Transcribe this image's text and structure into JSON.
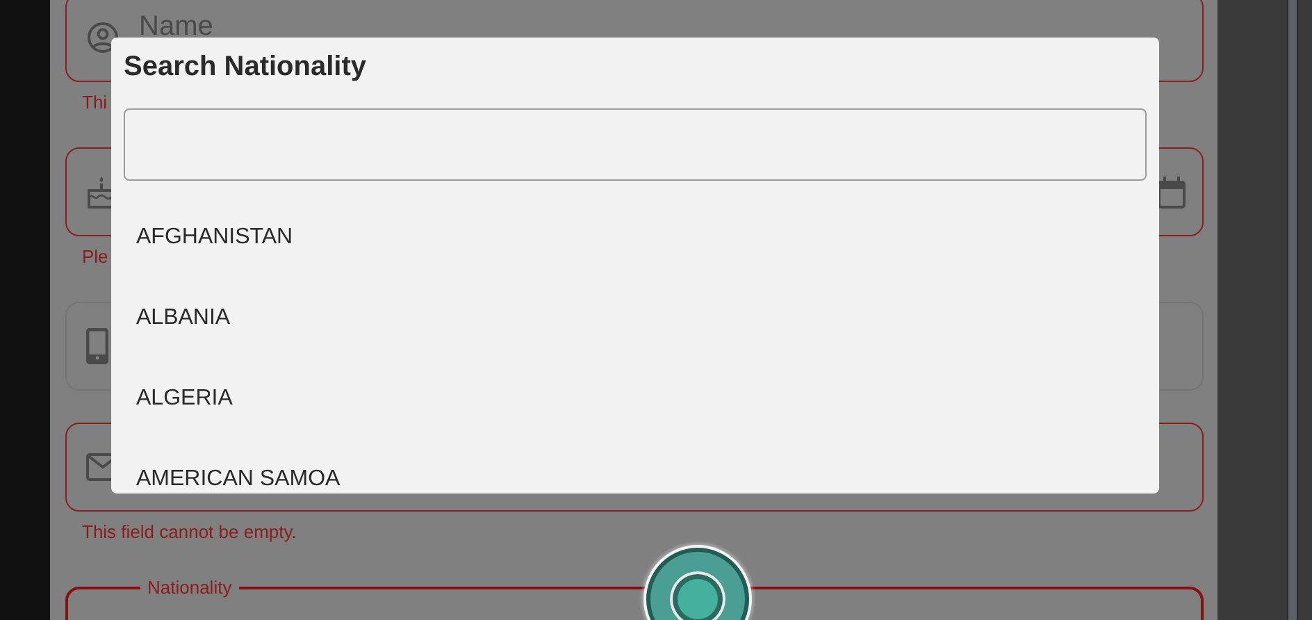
{
  "form": {
    "fields": [
      {
        "kind": "name",
        "label": "Name",
        "error": true,
        "helper": "Thi"
      },
      {
        "kind": "birthday",
        "error": true,
        "helper": "Ple"
      },
      {
        "kind": "phone",
        "error": false
      },
      {
        "kind": "email",
        "error": true,
        "helper": "This field cannot be empty."
      },
      {
        "kind": "select",
        "label": "Nationality",
        "error": true
      }
    ]
  },
  "dialog": {
    "title": "Search Nationality",
    "options": [
      "AFGHANISTAN",
      "ALBANIA",
      "ALGERIA",
      "AMERICAN SAMOA"
    ]
  }
}
